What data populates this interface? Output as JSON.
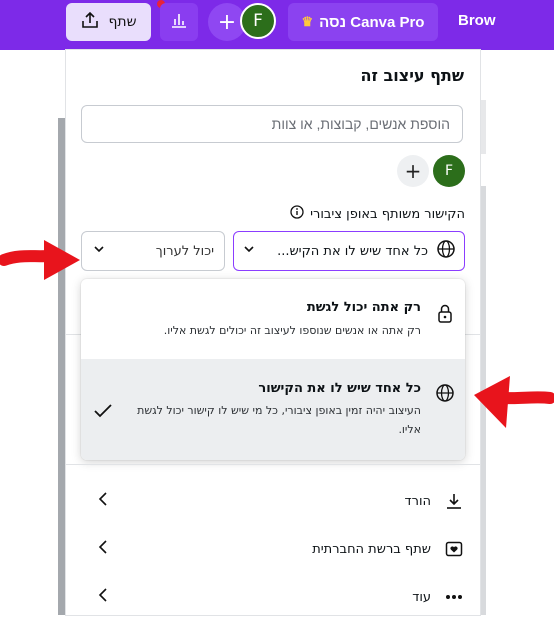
{
  "topbar": {
    "share_label": "שתף",
    "plan_label": "נסה Canva Pro",
    "browse_label": "Brow",
    "avatar_initial": "F",
    "add_symbol": "+"
  },
  "share_panel": {
    "title": "שתף עיצוב זה",
    "search_placeholder": "הוספת אנשים, קבוצות, או צוות",
    "collaborator_initial": "F",
    "add_collaborator_symbol": "+",
    "link_status": "הקישור משותף באופן ציבורי",
    "access_selected": "כל אחד שיש לו את הקיש...",
    "permission_selected": "יכול לערוך"
  },
  "access_menu": {
    "options": [
      {
        "title": "רק אתה יכול לגשת",
        "description": "רק אתה או אנשים שנוספו לעיצוב זה יכולים לגשת אליו."
      },
      {
        "title": "כל אחד שיש לו את הקישור",
        "description": "העיצוב יהיה זמין באופן ציבורי, כל מי שיש לו קישור יכול לגשת אליו."
      }
    ]
  },
  "actions": [
    {
      "label": "הורד",
      "icon": "download-icon"
    },
    {
      "label": "שתף ברשת החברתית",
      "icon": "heart-icon"
    },
    {
      "label": "עוד",
      "icon": "more-icon"
    }
  ],
  "colors": {
    "brand": "#7d2ae8",
    "selected_border": "#8b3dff",
    "annotation_arrow": "#e8141c",
    "avatar": "#2c6e1b"
  }
}
